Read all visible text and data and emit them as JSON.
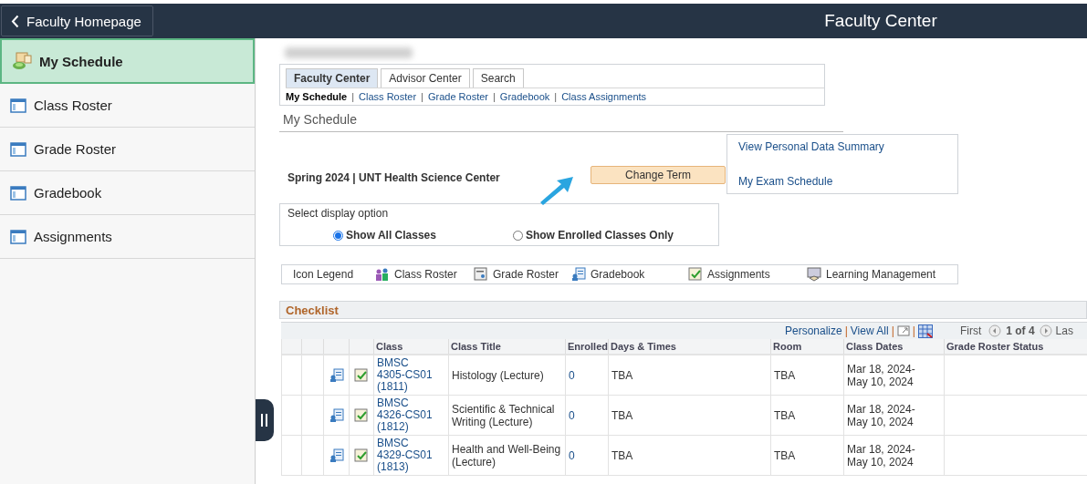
{
  "header": {
    "back_button": "Faculty Homepage",
    "title": "Faculty Center"
  },
  "sidebar": {
    "items": [
      {
        "label": "My Schedule",
        "selected": true
      },
      {
        "label": "Class Roster",
        "selected": false
      },
      {
        "label": "Grade Roster",
        "selected": false
      },
      {
        "label": "Gradebook",
        "selected": false
      },
      {
        "label": "Assignments",
        "selected": false
      }
    ]
  },
  "tabs": [
    {
      "label": "Faculty Center",
      "selected": true
    },
    {
      "label": "Advisor Center",
      "selected": false
    },
    {
      "label": "Search",
      "selected": false
    }
  ],
  "subnav": [
    {
      "label": "My Schedule",
      "selected": true
    },
    {
      "separator": "|",
      "label": "Class Roster",
      "selected": false
    },
    {
      "separator": "|",
      "label": "Grade Roster",
      "selected": false
    },
    {
      "separator": "|",
      "label": "Gradebook",
      "selected": false
    },
    {
      "separator": "|",
      "label": "Class Assignments",
      "selected": false
    }
  ],
  "page_title": "My Schedule",
  "term": "Spring 2024 | UNT Health Science Center",
  "change_term_button": "Change Term",
  "links": [
    "View Personal Data Summary",
    "My Exam Schedule"
  ],
  "display_option": {
    "label": "Select display option",
    "options": [
      {
        "label": "Show All Classes",
        "selected": true
      },
      {
        "label": "Show Enrolled Classes Only",
        "selected": false
      }
    ]
  },
  "icon_legend": {
    "label": "Icon Legend",
    "items": [
      "Class Roster",
      "Grade Roster",
      "Gradebook",
      "Assignments",
      "Learning Management"
    ]
  },
  "checklist": {
    "title": "Checklist",
    "toolbar": {
      "personalize": "Personalize",
      "separators": [
        "|",
        "|",
        "|"
      ],
      "view_all": "View All",
      "first": "First",
      "range": "1 of 4",
      "last": "Las"
    },
    "columns": [
      "Class",
      "Class Title",
      "Enrolled",
      "Days & Times",
      "Room",
      "Class Dates",
      "Grade Roster Status"
    ],
    "rows": [
      {
        "class": "BMSC 4305-CS01 (1811)",
        "title": "Histology (Lecture)",
        "enrolled": "0",
        "days": "TBA",
        "room": "TBA",
        "dates": "Mar 18, 2024- May 10, 2024"
      },
      {
        "class": "BMSC 4326-CS01 (1812)",
        "title": "Scientific & Technical Writing (Lecture)",
        "enrolled": "0",
        "days": "TBA",
        "room": "TBA",
        "dates": "Mar 18, 2024- May 10, 2024"
      },
      {
        "class": "BMSC 4329-CS01 (1813)",
        "title": "Health and Well-Being (Lecture)",
        "enrolled": "0",
        "days": "TBA",
        "room": "TBA",
        "dates": "Mar 18, 2024- May 10, 2024"
      }
    ]
  }
}
